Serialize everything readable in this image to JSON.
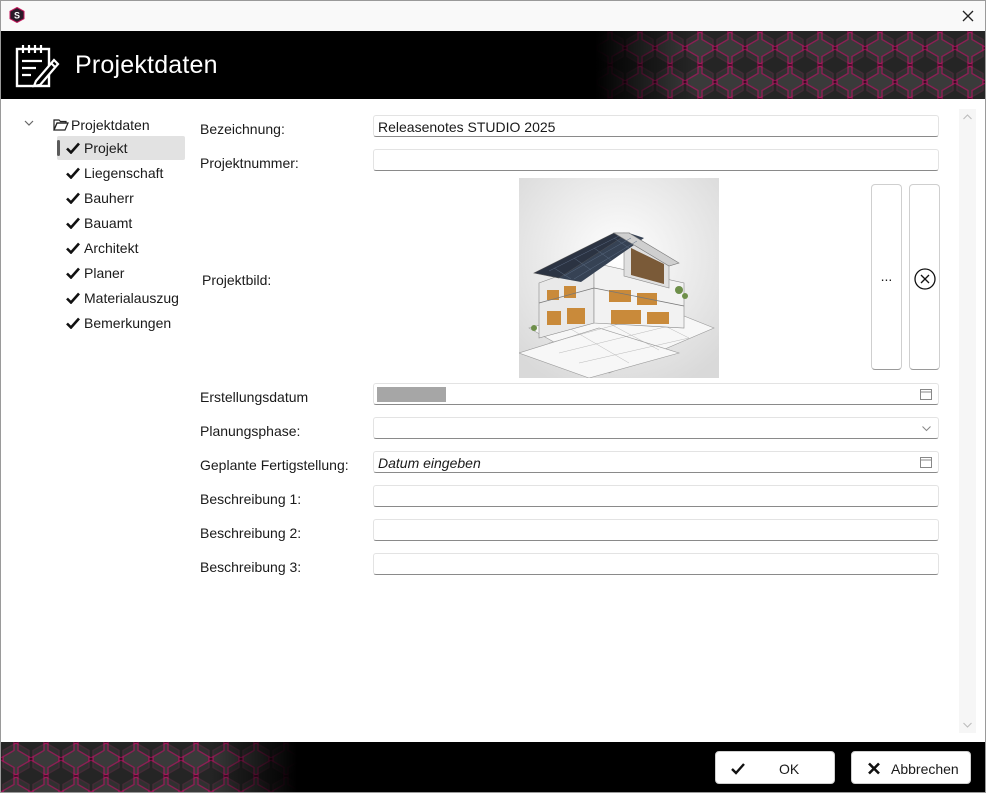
{
  "header": {
    "title": "Projektdaten"
  },
  "tree": {
    "root_label": "Projektdaten",
    "items": [
      {
        "label": "Projekt",
        "selected": true
      },
      {
        "label": "Liegenschaft"
      },
      {
        "label": "Bauherr"
      },
      {
        "label": "Bauamt"
      },
      {
        "label": "Architekt"
      },
      {
        "label": "Planer"
      },
      {
        "label": "Materialauszug"
      },
      {
        "label": "Bemerkungen"
      }
    ]
  },
  "form": {
    "bezeichnung": {
      "label": "Bezeichnung:",
      "value": "Releasenotes STUDIO 2025"
    },
    "projektnummer": {
      "label": "Projektnummer:",
      "value": ""
    },
    "projektbild": {
      "label": "Projektbild:",
      "browse_label": "..."
    },
    "erstellungsdatum": {
      "label": "Erstellungsdatum"
    },
    "planungsphase": {
      "label": "Planungsphase:",
      "value": ""
    },
    "fertigstellung": {
      "label": "Geplante Fertigstellung:",
      "placeholder": "Datum eingeben"
    },
    "beschreibung1": {
      "label": "Beschreibung 1:",
      "value": ""
    },
    "beschreibung2": {
      "label": "Beschreibung 2:",
      "value": ""
    },
    "beschreibung3": {
      "label": "Beschreibung 3:",
      "value": ""
    }
  },
  "footer": {
    "ok_label": "OK",
    "cancel_label": "Abbrechen"
  },
  "colors": {
    "accent": "#c2185b",
    "header_bg": "#000000",
    "selected_bg": "#e2e2e2"
  }
}
